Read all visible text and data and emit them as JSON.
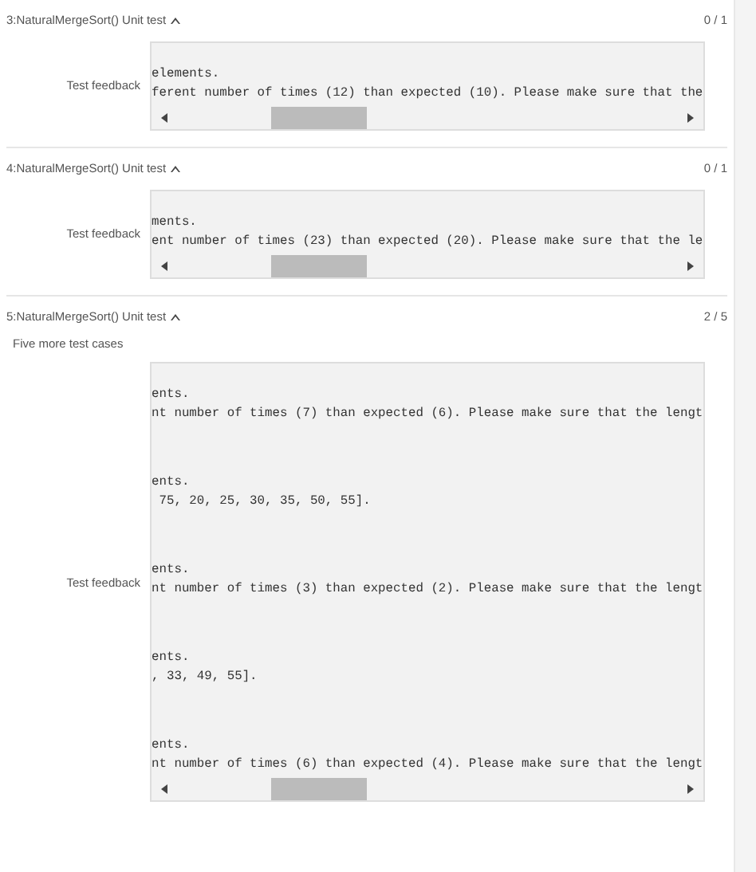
{
  "tests": [
    {
      "title": "3:NaturalMergeSort() Unit test",
      "expanded": true,
      "score": "0 / 1",
      "label": "Test feedback",
      "cases": [
        [
          "elements.",
          "ferent number of times (12) than expected (10). Please make sure that the"
        ]
      ]
    },
    {
      "title": "4:NaturalMergeSort() Unit test",
      "expanded": true,
      "score": "0 / 1",
      "label": "Test feedback",
      "cases": [
        [
          "ments.",
          "ent number of times (23) than expected (20). Please make sure that the le"
        ]
      ]
    },
    {
      "title": "5:NaturalMergeSort() Unit test",
      "expanded": true,
      "score": "2 / 5",
      "description": "Five more test cases",
      "label": "Test feedback",
      "cases": [
        [
          "ents.",
          "nt number of times (7) than expected (6). Please make sure that the lengt"
        ],
        [
          "ents.",
          " 75, 20, 25, 30, 35, 50, 55]."
        ],
        [
          "ents.",
          "nt number of times (3) than expected (2). Please make sure that the lengt"
        ],
        [
          "ents.",
          ", 33, 49, 55]."
        ],
        [
          "ents.",
          "nt number of times (6) than expected (4). Please make sure that the lengt"
        ]
      ]
    }
  ]
}
